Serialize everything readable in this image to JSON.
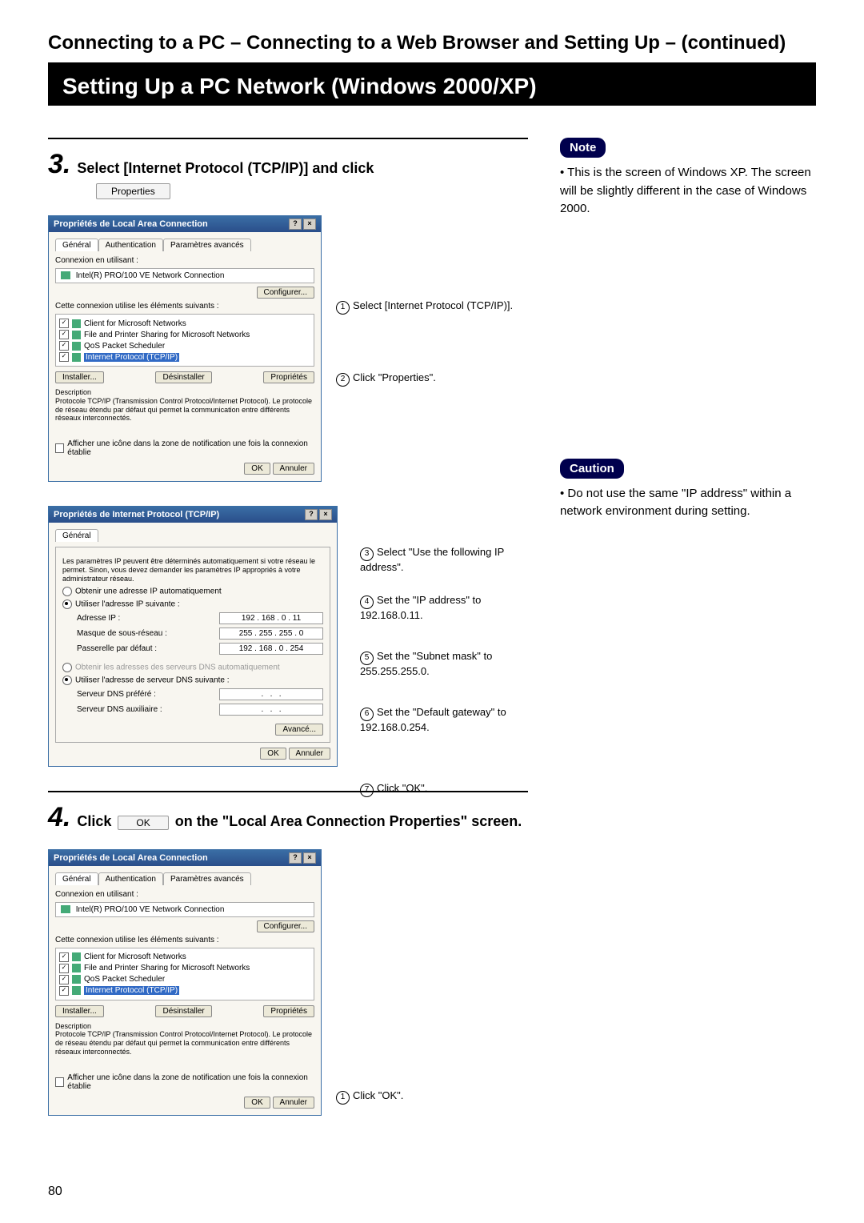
{
  "header": {
    "title": "Connecting to a PC – Connecting to a Web Browser and Setting Up – (continued)",
    "section_bar": "Setting Up a PC Network (Windows 2000/XP)"
  },
  "step3": {
    "number": "3.",
    "text": "Select [Internet Protocol (TCP/IP)] and click",
    "properties_btn": "Properties"
  },
  "step4": {
    "number": "4.",
    "text_a": "Click",
    "ok_btn": "OK",
    "text_b": "on the \"Local Area Connection Properties\" screen."
  },
  "note": {
    "label": "Note",
    "text": "This is the screen of Windows XP. The screen will be slightly different in the case of Windows 2000."
  },
  "caution": {
    "label": "Caution",
    "text": "Do not use the same \"IP address\" within a network environment during setting."
  },
  "dialog1": {
    "title": "Propriétés de Local Area Connection",
    "tabs": [
      "Général",
      "Authentication",
      "Paramètres avancés"
    ],
    "connect_label": "Connexion en utilisant :",
    "adapter": "Intel(R) PRO/100 VE Network Connection",
    "configure": "Configurer...",
    "elements_label": "Cette connexion utilise les éléments suivants :",
    "items": [
      "Client for Microsoft Networks",
      "File and Printer Sharing for Microsoft Networks",
      "QoS Packet Scheduler",
      "Internet Protocol (TCP/IP)"
    ],
    "btn_install": "Installer...",
    "btn_uninstall": "Désinstaller",
    "btn_properties": "Propriétés",
    "desc_label": "Description",
    "desc_text": "Protocole TCP/IP (Transmission Control Protocol/Internet Protocol). Le protocole de réseau étendu par défaut qui permet la communication entre différents réseaux interconnectés.",
    "show_icon": "Afficher une icône dans la zone de notification une fois la connexion établie",
    "ok": "OK",
    "cancel": "Annuler"
  },
  "dialog2": {
    "title": "Propriétés de Internet Protocol (TCP/IP)",
    "tab": "Général",
    "intro": "Les paramètres IP peuvent être déterminés automatiquement si votre réseau le permet. Sinon, vous devez demander les paramètres IP appropriés à votre administrateur réseau.",
    "radio_auto": "Obtenir une adresse IP automatiquement",
    "radio_manual": "Utiliser l'adresse IP suivante :",
    "ip_label": "Adresse IP :",
    "ip_val": "192 . 168 .   0  .  11",
    "mask_label": "Masque de sous-réseau :",
    "mask_val": "255 . 255 . 255 .   0",
    "gw_label": "Passerelle par défaut :",
    "gw_val": "192 . 168 .   0  . 254",
    "dns_auto": "Obtenir les adresses des serveurs DNS automatiquement",
    "dns_manual": "Utiliser l'adresse de serveur DNS suivante :",
    "dns_pref": "Serveur DNS préféré :",
    "dns_aux": "Serveur DNS auxiliaire :",
    "advanced": "Avancé...",
    "ok": "OK",
    "cancel": "Annuler"
  },
  "callouts": {
    "c1": "Select [Internet Protocol (TCP/IP)].",
    "c2": "Click \"Properties\".",
    "c3": "Select \"Use the following IP address\".",
    "c4": "Set the \"IP address\" to 192.168.0.11.",
    "c5": "Set the \"Subnet mask\" to 255.255.255.0.",
    "c6": "Set the \"Default gateway\" to 192.168.0.254.",
    "c7": "Click \"OK\".",
    "c8": "Click \"OK\"."
  },
  "page_number": "80"
}
